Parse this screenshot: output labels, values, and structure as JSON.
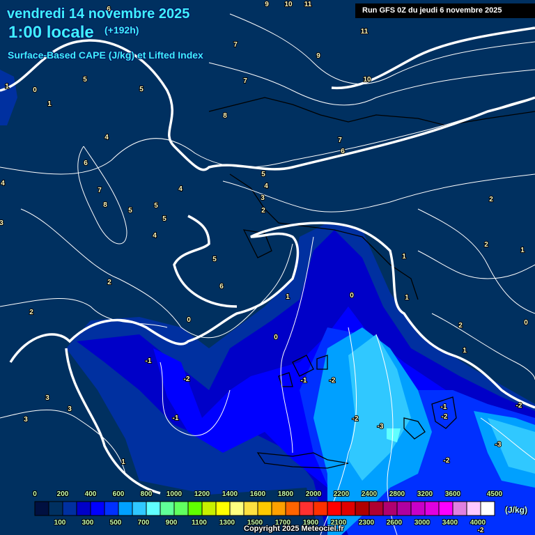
{
  "header": {
    "date": "vendredi 14 novembre 2025",
    "time": "1:00 locale",
    "lead": "(+192h)",
    "parameter": "Surface-Based CAPE (J/kg) et Lifted Index"
  },
  "run_info": "Run GFS 0Z du jeudi 6 novembre 2025",
  "legend": {
    "unit": "(J/kg)",
    "top_labels": [
      "0",
      "200",
      "400",
      "600",
      "800",
      "1000",
      "1200",
      "1400",
      "1600",
      "1800",
      "2000",
      "2200",
      "2400",
      "2800",
      "3200",
      "3600",
      "4500"
    ],
    "bottom_labels": [
      "100",
      "300",
      "500",
      "700",
      "900",
      "1100",
      "1300",
      "1500",
      "1700",
      "1900",
      "2100",
      "2300",
      "2600",
      "3000",
      "3400",
      "4000"
    ],
    "colors": [
      "#001040",
      "#003060",
      "#0030a0",
      "#0000c8",
      "#0000ff",
      "#0030ff",
      "#00a0ff",
      "#30c8ff",
      "#60ffff",
      "#60ff98",
      "#60ff60",
      "#60ff00",
      "#c8f000",
      "#ffff00",
      "#ffff80",
      "#ffe040",
      "#ffc800",
      "#ffa000",
      "#ff6400",
      "#ff3030",
      "#ff3000",
      "#ff0000",
      "#e00000",
      "#b00000",
      "#b00030",
      "#b00070",
      "#b000a0",
      "#c800c8",
      "#e000e0",
      "#ff00ff",
      "#e080e0",
      "#ffc8ff",
      "#ffffff"
    ]
  },
  "lifted_index_labels": [
    "9",
    "10",
    "11",
    "11",
    "9",
    "10",
    "7",
    "7",
    "8",
    "7",
    "6",
    "5",
    "4",
    "3",
    "2",
    "6",
    "5",
    "5",
    "1",
    "0",
    "1",
    "4",
    "6",
    "4",
    "7",
    "8",
    "5",
    "5",
    "5",
    "4",
    "5",
    "6",
    "2",
    "2",
    "0",
    "1",
    "0",
    "0",
    "1",
    "1",
    "2",
    "2",
    "1",
    "2",
    "0",
    "1",
    "3",
    "3",
    "3",
    "1",
    "-1",
    "-2",
    "-1",
    "-1",
    "-2",
    "-2",
    "-3",
    "-1",
    "-2",
    "-3",
    "-2",
    "-2",
    "-2",
    "4",
    "3"
  ],
  "copyright": "Copyright 2025 Meteociel.fr"
}
